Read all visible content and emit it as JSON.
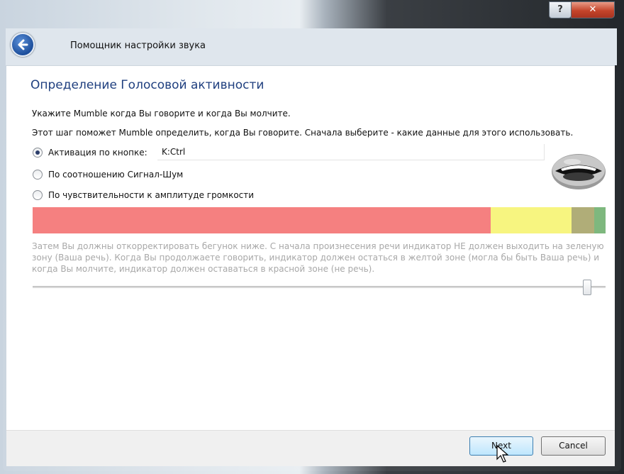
{
  "window": {
    "title": "Помощник настройки звука",
    "help_label": "?",
    "close_label": "✕"
  },
  "page": {
    "title": "Определение Голосовой активности",
    "intro1": "Укажите Mumble когда Вы говорите и когда Вы молчите.",
    "intro2": "Этот шаг поможет Mumble определить, когда Вы говорите. Сначала выберите - какие данные для этого использовать."
  },
  "options": {
    "push_to_talk": {
      "label": "Активация по кнопке:",
      "selected": true
    },
    "shortcut_value": "K:Ctrl",
    "snr": {
      "label": "По соотношению Сигнал-Шум",
      "selected": false
    },
    "amplitude": {
      "label": "По чувствительности к амплитуде громкости",
      "selected": false
    }
  },
  "meter": {
    "red_fraction": 0.8,
    "yellow_fraction": 0.14,
    "olive_fraction": 0.04,
    "green_fraction": 0.02,
    "colors": {
      "red": "#f58080",
      "yellow": "#f7f580",
      "olive": "#b0ad78",
      "green": "#7eb87e"
    }
  },
  "instructions": "Затем Вы должны откорректировать бегунок ниже. С начала произнесения речи индикатор НЕ должен выходить на зеленую зону (Ваша речь). Когда Вы продолжаете говорить, индикатор должен остаться в желтой зоне (могла бы быть Ваша речь) и когда Вы молчите, индикатор должен оставаться в красной зоне (не речь).",
  "slider": {
    "value_fraction": 0.97
  },
  "buttons": {
    "next": "Next",
    "cancel": "Cancel"
  }
}
